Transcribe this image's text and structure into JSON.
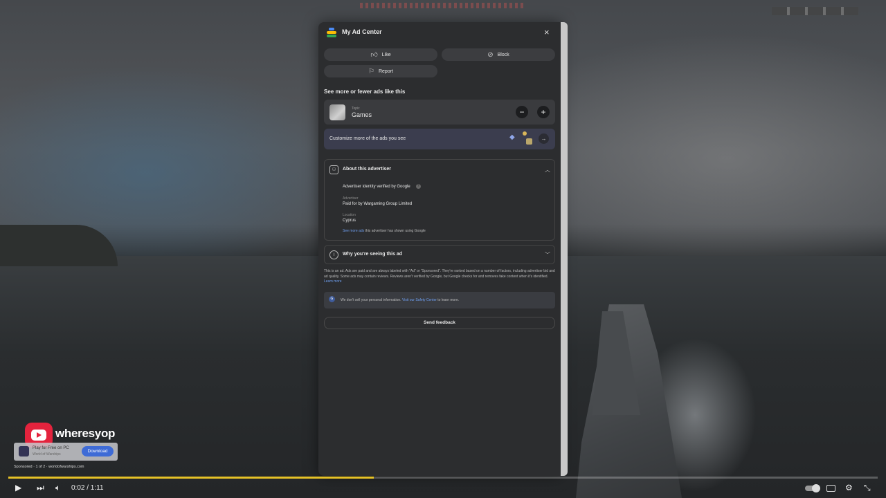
{
  "panel": {
    "title": "My Ad Center",
    "close_icon": "×",
    "actions": {
      "like": "Like",
      "block": "Block",
      "report": "Report"
    },
    "section_title": "See more or fewer ads like this",
    "topic": {
      "caption": "Topic",
      "name": "Games",
      "minus": "−",
      "plus": "+"
    },
    "customize": "Customize more of the ads you see",
    "about": {
      "title": "About this advertiser",
      "verified": "Advertiser identity verified by Google",
      "advertiser_label": "Advertiser",
      "advertiser_value": "Paid for by Wargaming Group Limited",
      "location_label": "Location",
      "location_value": "Cyprus",
      "see_more_link": "See more ads",
      "see_more_rest": " this advertiser has shown using Google"
    },
    "why": {
      "title": "Why you're seeing this ad"
    },
    "disclaimer": "This is an ad. Ads are paid and are always labeled with \"Ad\" or \"Sponsored\". They're ranked based on a number of factors, including advertiser bid and ad quality. Some ads may contain reviews. Reviews aren't verified by Google, but Google checks for and removes fake content when it's identified.",
    "learn_more": "Learn more",
    "privacy": {
      "pre": "We don't sell your personal information. ",
      "link": "Visit our Safety Center",
      "post": " to learn more."
    },
    "feedback": "Send feedback"
  },
  "overlay": {
    "channel": "wheresyop",
    "ad_title": "Play for Free on PC",
    "ad_sub": "World of Warships",
    "download": "Download",
    "sponsored": "Sponsored · 1 of 2 · worldofwarships.com"
  },
  "player": {
    "time": "0:02 / 1:11",
    "progress": 0.42
  },
  "colors": {
    "progress": "#e6c227",
    "youtube": "#e4233d",
    "accent_link": "#6f9ff0"
  }
}
